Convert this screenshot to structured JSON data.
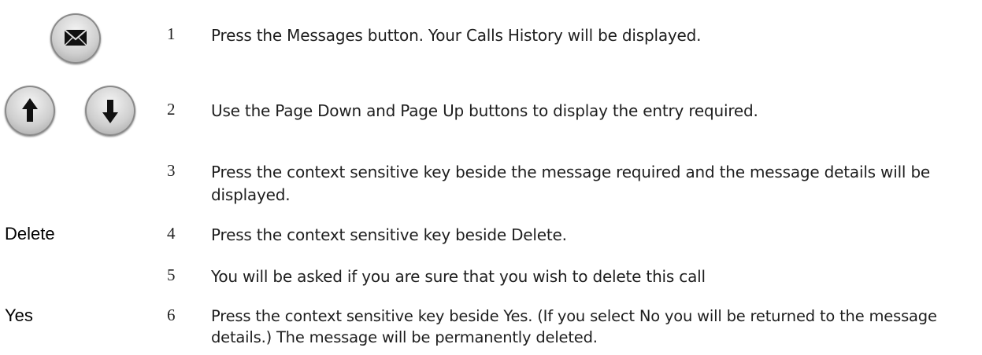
{
  "icons": {
    "messages": "envelope-icon",
    "page_up": "arrow-up-icon",
    "page_down": "arrow-down-icon"
  },
  "steps": [
    {
      "number": "1",
      "text": "Press the Messages button.  Your Calls History will be displayed."
    },
    {
      "number": "2",
      "text": "Use the Page Down and Page Up buttons to display the entry required."
    },
    {
      "number": "3",
      "text": "Press the context sensitive key beside the message required and the message details will be displayed."
    },
    {
      "number": "4",
      "label": "Delete",
      "text": "Press the context sensitive key beside Delete."
    },
    {
      "number": "5",
      "text": "You will be asked if you are sure that you wish to delete this call"
    },
    {
      "number": "6",
      "label": "Yes",
      "text": "Press the context sensitive key beside Yes.  (If you select No you will be returned to the message details.)  The message will be permanently deleted."
    }
  ]
}
